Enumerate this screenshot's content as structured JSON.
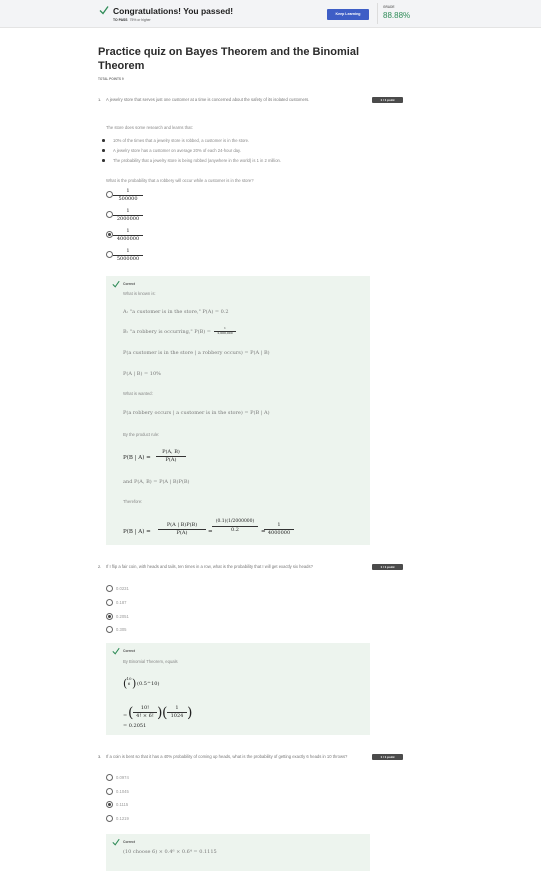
{
  "banner": {
    "congrats": "Congratulations! You passed!",
    "to_pass_label": "TO PASS",
    "to_pass_value": "75% or higher",
    "keep_learning": "Keep Learning",
    "grade_label": "GRADE",
    "grade_value": "88.88%"
  },
  "quiz": {
    "title": "Practice quiz on Bayes Theorem and the Binomial Theorem",
    "total_points": "TOTAL POINTS 9"
  },
  "q1": {
    "number": "1.",
    "badge": "1 / 1 point",
    "text": "A jewelry store that serves just one customer at a time is concerned about the safety of its isolated customers.",
    "intro": "The store does some research and learns that:",
    "facts": [
      "10% of the times that a jewelry store is robbed, a customer is in the store.",
      "A jewelry store has a customer on average 20% of each 24-hour day.",
      "The probability that a jewelry store is being robbed (anywhere in the world) is 1 in 2 million."
    ],
    "question": "What is the probability that a robbery will occur while a customer is in the store?",
    "options": [
      {
        "num": "1",
        "den": "500000"
      },
      {
        "num": "1",
        "den": "2000000"
      },
      {
        "num": "1",
        "den": "4000000"
      },
      {
        "num": "1",
        "den": "5000000"
      }
    ],
    "selected": 2,
    "feedback": {
      "correct": "Correct",
      "known": "What is known is:",
      "line_a": "A: \"a customer is in the store,\" P(A) = 0.2",
      "line_b": "B: \"a robbery is occurring,\" P(B) =",
      "line_b_num": "1",
      "line_b_den": "2,000,000",
      "line_cond": "P(a customer is in the store | a robbery occurs) = P(A | B)",
      "line_cond2": "P(A | B) = 10%",
      "wanted": "What is wanted:",
      "line_want": "P(a robbery occurs | a customer is in the store) = P(B | A)",
      "product_rule": "By the product rule:",
      "pr_lhs": "P(B | A) =",
      "pr_num": "P(A, B)",
      "pr_den": "P(A)",
      "and_line": "and P(A, B) = P(A | B)P(B)",
      "therefore": "Therefore:",
      "t_lhs": "P(B | A) =",
      "t_f1_num": "P(A | B)P(B)",
      "t_f1_den": "P(A)",
      "t_eq1": "=",
      "t_f2_num": "(0.1)(1/2000000)",
      "t_f2_den": "0.2",
      "t_eq2": "=",
      "t_f3_num": "1",
      "t_f3_den": "4000000"
    }
  },
  "q2": {
    "number": "2.",
    "badge": "1 / 1 point",
    "text": "If I flip a fair coin, with heads and tails, ten times in a row, what is the probability that I will get exactly six heads?",
    "options": [
      "0.0231",
      "0.187",
      "0.2051",
      "0.305"
    ],
    "selected": 2,
    "feedback": {
      "correct": "Correct",
      "by": "By Binomial Theorem, equals",
      "binom_top": "10",
      "binom_bot": "6",
      "pow": "(0.5^10)",
      "eq": "=",
      "f1_num": "10!",
      "f1_den": "4! × 6!",
      "f2_num": "1",
      "f2_den": "1024",
      "result": "= 0.2051"
    }
  },
  "q3": {
    "number": "3.",
    "badge": "1 / 1 point",
    "text": "If a coin is bent so that it has a 40% probability of coming up heads, what is the probability of getting exactly 6 heads in 10 throws?",
    "options": [
      "0.0974",
      "0.1045",
      "0.1115",
      "0.1219"
    ],
    "selected": 2,
    "feedback": {
      "correct": "Correct",
      "formula": "(10 choose 6) × 0.4⁶ × 0.6⁴ = 0.1115"
    }
  },
  "colors": {
    "check_green": "#2e8b57",
    "button_blue": "#3e5ec6",
    "feedback_bg": "#edf4ee",
    "badge_bg": "#4b4b4b"
  }
}
